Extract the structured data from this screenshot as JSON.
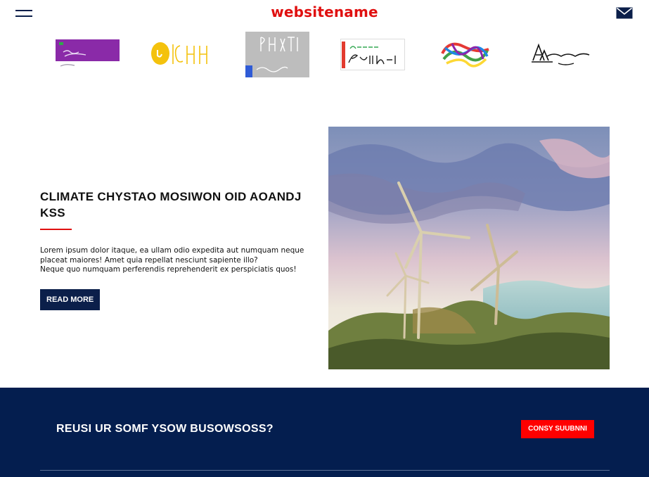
{
  "header": {
    "site_name": "websitename"
  },
  "icons": {
    "menu": "hamburger-menu-icon",
    "mail": "envelope-icon"
  },
  "colors": {
    "brand_red": "#e01010",
    "navy": "#041e4f",
    "button_red": "#ff0000"
  },
  "feature": {
    "title": "CLIMATE CHYSTAO MOSIWON OID AOANDJ KSS",
    "body_line1": "Lorem ipsum dolor itaque, ea ullam odio expedita aut numquam neque placeat maiores! Amet quia repellat nesciunt sapiente illo?",
    "body_line2": "Neque quo numquam perferendis reprehenderit ex perspiciatis quos!",
    "read_more": "READ MORE"
  },
  "cta": {
    "text": "REUSI UR SOMF YSOW BUSOWSOSS?",
    "button": "CONSY SUUBNNI"
  }
}
